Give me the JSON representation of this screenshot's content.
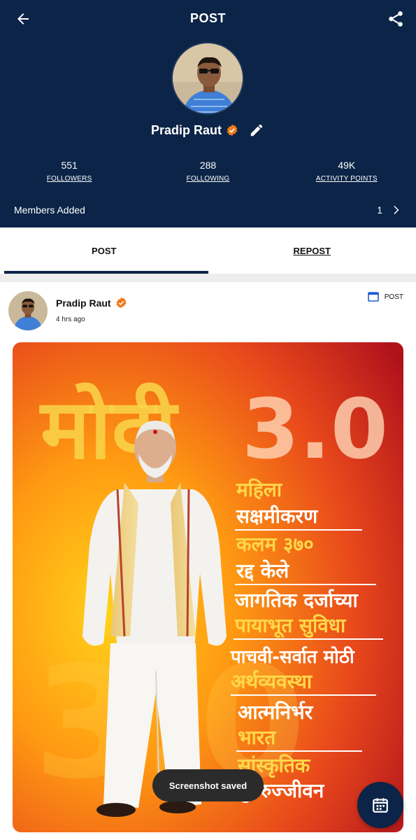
{
  "header": {
    "title": "POST",
    "back_icon": "arrow-left-icon",
    "share_icon": "share-icon"
  },
  "profile": {
    "name": "Pradip Raut",
    "verified_icon": "verified-badge-icon",
    "edit_icon": "pencil-icon",
    "stats": [
      {
        "value": "551",
        "label": "FOLLOWERS"
      },
      {
        "value": "288",
        "label": "FOLLOWING"
      },
      {
        "value": "49K",
        "label": "ACTIVITY POINTS"
      }
    ],
    "members_added_label": "Members Added",
    "members_added_count": "1"
  },
  "tabs": [
    {
      "label": "POST",
      "active": true
    },
    {
      "label": "REPOST",
      "active": false
    }
  ],
  "post": {
    "author": "Pradip Raut",
    "time": "4 hrs ago",
    "type_label": "POST",
    "image": {
      "headline_left": "मोदी",
      "headline_right": "3.0",
      "lines": [
        {
          "text": "महिला",
          "color": "#ffd84a"
        },
        {
          "text": "सक्षमीकरण",
          "color": "#ffffff"
        },
        {
          "text": "कलम ३७०",
          "color": "#ffd84a"
        },
        {
          "text": "रद्द केले",
          "color": "#ffffff"
        },
        {
          "text": "जागतिक दर्जाच्या",
          "color": "#ffffff"
        },
        {
          "text": "पायाभूत सुविधा",
          "color": "#ffd84a"
        },
        {
          "text": "पाचवी-सर्वात मोठी",
          "color": "#ffffff"
        },
        {
          "text": "अर्थव्यवस्था",
          "color": "#ffd84a"
        },
        {
          "text": "आत्मनिर्भर",
          "color": "#ffffff"
        },
        {
          "text": "भारत",
          "color": "#ffd84a"
        },
        {
          "text": "सांस्कृतिक",
          "color": "#ffd84a"
        },
        {
          "text": "पुनरुज्जीवन",
          "color": "#ffffff"
        }
      ]
    }
  },
  "toast": {
    "text": "Screenshot saved"
  },
  "fab": {
    "icon": "calendar-icon"
  },
  "colors": {
    "header_bg": "#0b2447",
    "accent_badge": "#f07a1a"
  }
}
